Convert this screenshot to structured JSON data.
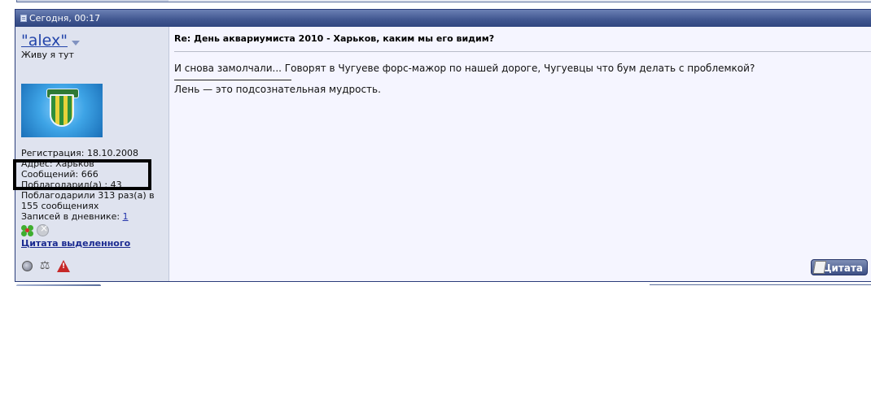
{
  "post": {
    "date": "Сегодня, 00:17",
    "user": {
      "username": "\"alex\"",
      "title": "Живу я тут",
      "registration": "Регистрация: 18.10.2008",
      "address": "Адрес: Харьков",
      "posts": "Сообщений: 666",
      "thanked": "Поблагодарил(а) : 43",
      "thanks_received": "Поблагодарили 313 раз(а) в 155 сообщениях",
      "diary_label": "Записей в дневнике: ",
      "diary_count": "1",
      "quote_selected": "Цитата выделенного"
    },
    "title": "Re: День аквариумиста 2010 - Харьков, каким мы его видим?",
    "message": "И снова замолчали... Говорят в Чугуеве форс-мажор по нашей дороге, Чугуевцы что бум делать с проблемкой?",
    "signature": "Лень — это подсознательная мудрость.",
    "quote_button": "Цитата"
  },
  "colors": {
    "header_bar": "#3f558f",
    "user_panel": "#dfe3ef",
    "link": "#2244aa",
    "highlight_box": "#000000"
  },
  "icons": [
    "post-icon",
    "menu-arrow-icon",
    "avatar-image",
    "flower-icon",
    "ignore-icon",
    "online-status-icon",
    "reputation-icon",
    "report-icon",
    "quote-pen-icon"
  ]
}
